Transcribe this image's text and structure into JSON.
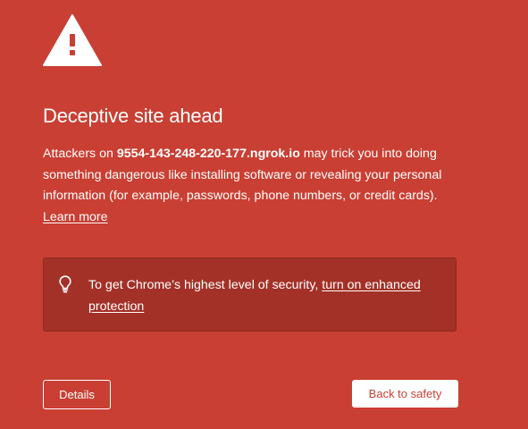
{
  "icon": "warning-triangle-icon",
  "title": "Deceptive site ahead",
  "message": {
    "prefix": "Attackers on ",
    "domain": "9554-143-248-220-177.ngrok.io",
    "suffix": " may trick you into doing something dangerous like installing software or revealing your personal information (for example, passwords, phone numbers, or credit cards). ",
    "learn_more": "Learn more"
  },
  "enhanced_protection": {
    "icon": "lightbulb-icon",
    "prefix": "To get Chrome’s highest level of security, ",
    "link": "turn on enhanced protection"
  },
  "buttons": {
    "details": "Details",
    "back_to_safety": "Back to safety"
  },
  "colors": {
    "background": "#c93f33",
    "box_background": "#a33127",
    "text": "#ffffff"
  }
}
